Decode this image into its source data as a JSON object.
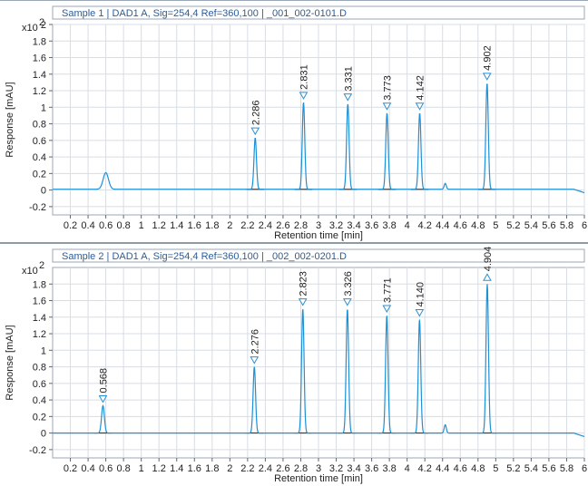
{
  "chart_data": [
    {
      "type": "line",
      "title": "Sample 1 | DAD1 A, Sig=254,4 Ref=360,100 | _001_002-0101.D",
      "xlabel": "Retention time [min]",
      "ylabel": "Response [mAU]",
      "y_multiplier_label": "x10",
      "y_multiplier_exp": "2",
      "xlim": [
        0,
        6
      ],
      "ylim": [
        -0.3,
        2.0
      ],
      "x_ticks": [
        "0.2",
        "0.4",
        "0.6",
        "0.8",
        "1",
        "1.2",
        "1.4",
        "1.6",
        "1.8",
        "2",
        "2.2",
        "2.4",
        "2.6",
        "2.8",
        "3",
        "3.2",
        "3.4",
        "3.6",
        "3.8",
        "4",
        "4.2",
        "4.4",
        "4.6",
        "4.8",
        "5",
        "5.2",
        "5.4",
        "5.6",
        "5.8",
        "6"
      ],
      "y_ticks": [
        "-0.2",
        "0",
        "0.2",
        "0.4",
        "0.6",
        "0.8",
        "1",
        "1.2",
        "1.4",
        "1.6",
        "1.8",
        "2"
      ],
      "baseline": 0.01,
      "peaks": [
        {
          "rt": 0.6,
          "height": 0.2,
          "width": 0.03,
          "label": ""
        },
        {
          "rt": 2.286,
          "height": 0.62,
          "width": 0.014,
          "label": "2.286"
        },
        {
          "rt": 2.831,
          "height": 1.05,
          "width": 0.014,
          "label": "2.831"
        },
        {
          "rt": 3.331,
          "height": 1.03,
          "width": 0.014,
          "label": "3.331"
        },
        {
          "rt": 3.773,
          "height": 0.92,
          "width": 0.014,
          "label": "3.773"
        },
        {
          "rt": 4.142,
          "height": 0.92,
          "width": 0.014,
          "label": "4.142"
        },
        {
          "rt": 4.43,
          "height": 0.07,
          "width": 0.012,
          "label": ""
        },
        {
          "rt": 4.902,
          "height": 1.28,
          "width": 0.014,
          "label": "4.902"
        }
      ]
    },
    {
      "type": "line",
      "title": "Sample 2 | DAD1 A, Sig=254,4 Ref=360,100 | _002_002-0201.D",
      "xlabel": "Retention time [min]",
      "ylabel": "Response [mAU]",
      "y_multiplier_label": "x10",
      "y_multiplier_exp": "2",
      "xlim": [
        0,
        6
      ],
      "ylim": [
        -0.3,
        2.0
      ],
      "x_ticks": [
        "0.2",
        "0.4",
        "0.6",
        "0.8",
        "1",
        "1.2",
        "1.4",
        "1.6",
        "1.8",
        "2",
        "2.2",
        "2.4",
        "2.6",
        "2.8",
        "3",
        "3.2",
        "3.4",
        "3.6",
        "3.8",
        "4",
        "4.2",
        "4.4",
        "4.6",
        "4.8",
        "5",
        "5.2",
        "5.4",
        "5.6",
        "5.8",
        "6"
      ],
      "y_ticks": [
        "-0.2",
        "0",
        "0.2",
        "0.4",
        "0.6",
        "0.8",
        "1",
        "1.2",
        "1.4",
        "1.6",
        "1.8"
      ],
      "baseline": 0.0,
      "peaks": [
        {
          "rt": 0.568,
          "height": 0.33,
          "width": 0.016,
          "label": "0.568"
        },
        {
          "rt": 2.276,
          "height": 0.8,
          "width": 0.014,
          "label": "2.276"
        },
        {
          "rt": 2.823,
          "height": 1.5,
          "width": 0.014,
          "label": "2.823"
        },
        {
          "rt": 3.326,
          "height": 1.5,
          "width": 0.014,
          "label": "3.326"
        },
        {
          "rt": 3.771,
          "height": 1.42,
          "width": 0.014,
          "label": "3.771"
        },
        {
          "rt": 4.14,
          "height": 1.37,
          "width": 0.014,
          "label": "4.140"
        },
        {
          "rt": 4.43,
          "height": 0.1,
          "width": 0.012,
          "label": ""
        },
        {
          "rt": 4.904,
          "height": 1.8,
          "width": 0.014,
          "label": "4.904",
          "marker": "up"
        }
      ]
    }
  ],
  "colors": {
    "trace": "#1e90d6",
    "marker": "#2b8fd6",
    "grid": "#d7dde4",
    "axis": "#9aa7b5",
    "title_text": "#2a5d9a"
  }
}
